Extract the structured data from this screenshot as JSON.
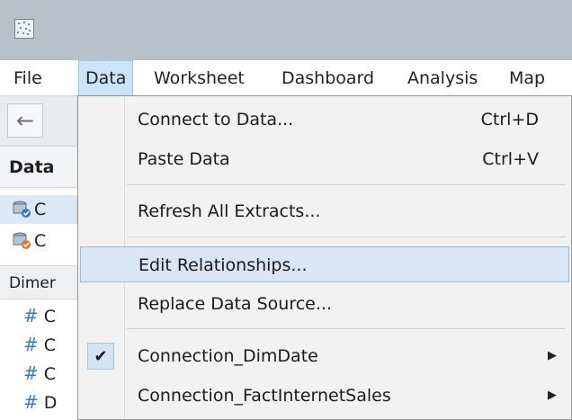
{
  "menubar": {
    "items": [
      {
        "label": "File",
        "active": false
      },
      {
        "label": "Data",
        "active": true
      },
      {
        "label": "Worksheet",
        "active": false
      },
      {
        "label": "Dashboard",
        "active": false
      },
      {
        "label": "Analysis",
        "active": false
      },
      {
        "label": "Map",
        "active": false
      }
    ]
  },
  "leftpane": {
    "data_tab": "Data",
    "connections": [
      "C",
      "C"
    ],
    "dimensions_label": "Dimer",
    "fields": [
      "C",
      "C",
      "C",
      "D"
    ]
  },
  "data_menu": {
    "connect": {
      "label": "Connect to Data...",
      "shortcut": "Ctrl+D"
    },
    "paste": {
      "label": "Paste Data",
      "shortcut": "Ctrl+V"
    },
    "refresh": {
      "label": "Refresh All Extracts..."
    },
    "edit_rel": {
      "label": "Edit Relationships..."
    },
    "replace": {
      "label": "Replace Data Source..."
    },
    "conn_dimdate": {
      "label": "Connection_DimDate",
      "checked": true
    },
    "conn_fact": {
      "label": "Connection_FactInternetSales",
      "checked": false
    }
  },
  "colors": {
    "titlebar": "#b6c1cc",
    "menu_active": "#cde4f7",
    "menu_hover": "#d9e6f5",
    "field_icon": "#3a7cc4"
  }
}
